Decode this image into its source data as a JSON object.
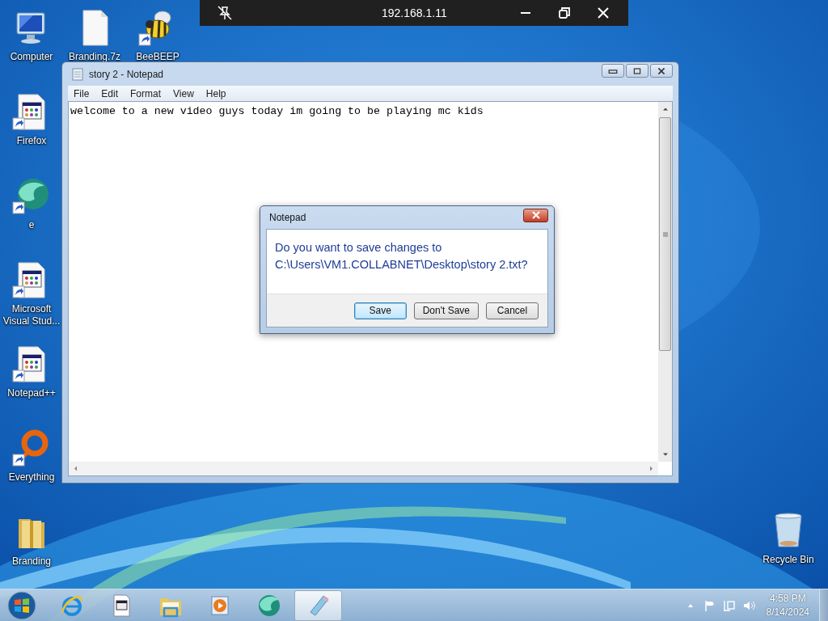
{
  "remote_bar": {
    "title": "192.168.1.11"
  },
  "top_row_icons": [
    {
      "kind": "computer",
      "label": "Computer",
      "shortcut": false
    },
    {
      "kind": "file",
      "label": "Branding.7z",
      "shortcut": false
    },
    {
      "kind": "bee",
      "label": "BeeBEEP",
      "shortcut": true
    }
  ],
  "left_column_icons": [
    {
      "kind": "app",
      "label": "Firefox",
      "shortcut": true
    },
    {
      "kind": "globe",
      "label": "e",
      "shortcut": true
    },
    {
      "kind": "app",
      "label": "Microsoft Visual Stud...",
      "shortcut": true
    },
    {
      "kind": "app",
      "label": "Notepad++",
      "shortcut": true
    },
    {
      "kind": "ring",
      "label": "Everything",
      "shortcut": true
    },
    {
      "kind": "folder",
      "label": "Branding",
      "shortcut": false
    }
  ],
  "recycle_bin": {
    "label": "Recycle Bin"
  },
  "notepad": {
    "title": "story 2 - Notepad",
    "menu": [
      "File",
      "Edit",
      "Format",
      "View",
      "Help"
    ],
    "text": "welcome to a new video guys today im going to be playing mc kids"
  },
  "dialog": {
    "title": "Notepad",
    "message": [
      "Do you want to save changes to",
      "C:\\Users\\VM1.COLLABNET\\Desktop\\story 2.txt?"
    ],
    "buttons": [
      {
        "label": "Save",
        "default": true
      },
      {
        "label": "Don't Save",
        "default": false
      },
      {
        "label": "Cancel",
        "default": false
      }
    ]
  },
  "taskbar": {
    "items": [
      {
        "kind": "browser",
        "active": false
      },
      {
        "kind": "app",
        "active": false
      },
      {
        "kind": "explorer",
        "active": false
      },
      {
        "kind": "media",
        "active": false
      },
      {
        "kind": "globe",
        "active": false
      },
      {
        "kind": "notepad",
        "active": true
      }
    ],
    "time": "4:58 PM",
    "date": "8/14/2024"
  }
}
